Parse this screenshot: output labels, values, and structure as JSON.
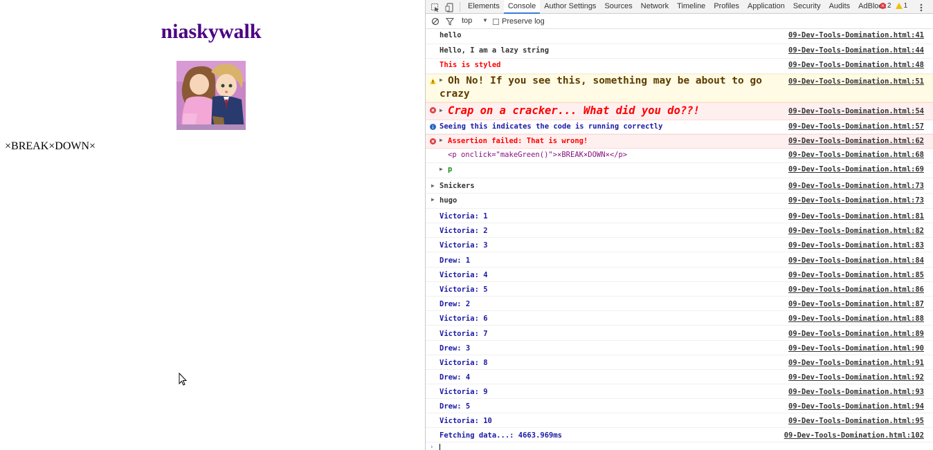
{
  "page": {
    "title": "niaskywalk",
    "break_text": "×BREAK×DOWN×"
  },
  "devtools": {
    "tabs": [
      "Elements",
      "Console",
      "Author Settings",
      "Sources",
      "Network",
      "Timeline",
      "Profiles",
      "Application",
      "Security",
      "Audits",
      "AdBlock"
    ],
    "active_tab": "Console",
    "error_count": "2",
    "warning_count": "1",
    "context": "top",
    "preserve_log_label": "Preserve log",
    "preserve_log_checked": false
  },
  "console": {
    "messages": [
      {
        "text": "hello",
        "source": "09-Dev-Tools-Domination.html:41",
        "color": "#333333"
      },
      {
        "text": "Hello, I am a lazy string",
        "source": "09-Dev-Tools-Domination.html:44",
        "color": "#333333"
      },
      {
        "text": "This is styled",
        "source": "09-Dev-Tools-Domination.html:48",
        "color": "#ff0000"
      },
      {
        "text": "Oh No! If you see this, something may be about to go",
        "text2": "crazy",
        "source": "09-Dev-Tools-Domination.html:51",
        "color": "#5c3b00"
      },
      {
        "text": "Crap on a cracker... What did you do??!",
        "source": "09-Dev-Tools-Domination.html:54",
        "color": "#ff0000"
      },
      {
        "text": "Seeing this indicates the code is running correctly",
        "source": "09-Dev-Tools-Domination.html:57",
        "color": "#1a1aa6"
      },
      {
        "text": "Assertion failed: That is wrong!",
        "source": "09-Dev-Tools-Domination.html:62",
        "color": "#ff0000"
      },
      {
        "text": "<p onclick=\"makeGreen()\">×BREAK×DOWN×</p>",
        "source": "09-Dev-Tools-Domination.html:68",
        "color": "#333333"
      },
      {
        "text": "p",
        "source": "09-Dev-Tools-Domination.html:69",
        "color": "#1a8a1a"
      },
      {
        "text": "Snickers",
        "source": "09-Dev-Tools-Domination.html:73",
        "color": "#333333"
      },
      {
        "text": "hugo",
        "source": "09-Dev-Tools-Domination.html:73",
        "color": "#333333"
      },
      {
        "text": "Victoria: 1",
        "source": "09-Dev-Tools-Domination.html:81",
        "color": "#1a1aa6"
      },
      {
        "text": "Victoria: 2",
        "source": "09-Dev-Tools-Domination.html:82",
        "color": "#1a1aa6"
      },
      {
        "text": "Victoria: 3",
        "source": "09-Dev-Tools-Domination.html:83",
        "color": "#1a1aa6"
      },
      {
        "text": "Drew: 1",
        "source": "09-Dev-Tools-Domination.html:84",
        "color": "#1a1aa6"
      },
      {
        "text": "Victoria: 4",
        "source": "09-Dev-Tools-Domination.html:85",
        "color": "#1a1aa6"
      },
      {
        "text": "Victoria: 5",
        "source": "09-Dev-Tools-Domination.html:86",
        "color": "#1a1aa6"
      },
      {
        "text": "Drew: 2",
        "source": "09-Dev-Tools-Domination.html:87",
        "color": "#1a1aa6"
      },
      {
        "text": "Victoria: 6",
        "source": "09-Dev-Tools-Domination.html:88",
        "color": "#1a1aa6"
      },
      {
        "text": "Victoria: 7",
        "source": "09-Dev-Tools-Domination.html:89",
        "color": "#1a1aa6"
      },
      {
        "text": "Drew: 3",
        "source": "09-Dev-Tools-Domination.html:90",
        "color": "#1a1aa6"
      },
      {
        "text": "Victoria: 8",
        "source": "09-Dev-Tools-Domination.html:91",
        "color": "#1a1aa6"
      },
      {
        "text": "Drew: 4",
        "source": "09-Dev-Tools-Domination.html:92",
        "color": "#1a1aa6"
      },
      {
        "text": "Victoria: 9",
        "source": "09-Dev-Tools-Domination.html:93",
        "color": "#1a1aa6"
      },
      {
        "text": "Drew: 5",
        "source": "09-Dev-Tools-Domination.html:94",
        "color": "#1a1aa6"
      },
      {
        "text": "Victoria: 10",
        "source": "09-Dev-Tools-Domination.html:95",
        "color": "#1a1aa6"
      },
      {
        "text": "Fetching data...: 4663.969ms",
        "source": "09-Dev-Tools-Domination.html:102",
        "color": "#1a1aa6"
      }
    ]
  },
  "colors": {
    "title": "#4b0082",
    "tab_active_underline": "#3879d9",
    "error_bg": "#fff0f0",
    "warning_bg": "#fffbe5",
    "info": "#1a1aa6",
    "error_text": "#ff0000"
  },
  "icons": [
    "inspect-icon",
    "device-icon",
    "clear-console-icon",
    "filter-icon",
    "error-icon",
    "warning-icon",
    "info-icon",
    "kebab-menu-icon",
    "mouse-cursor-icon"
  ]
}
